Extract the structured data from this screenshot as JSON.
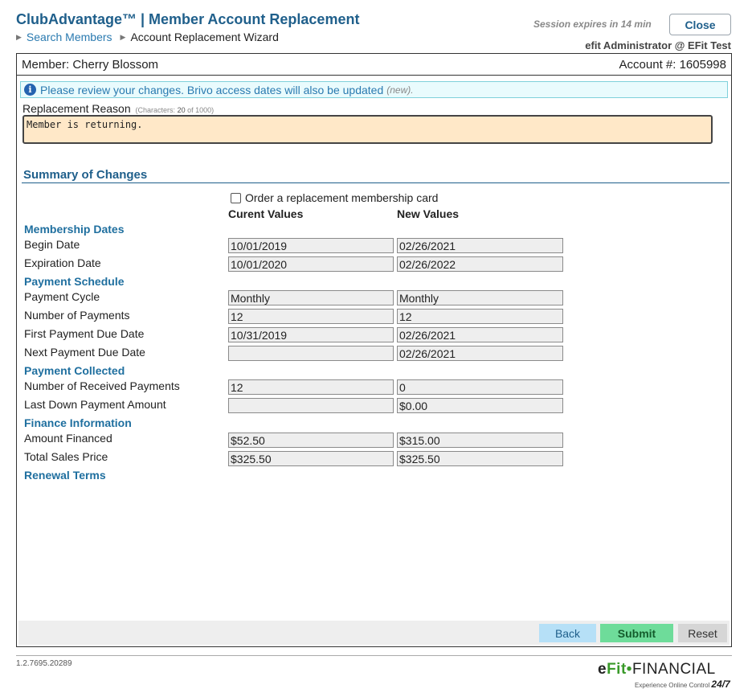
{
  "header": {
    "title": "ClubAdvantage™ | Member Account Replacement",
    "breadcrumb": [
      "Search Members",
      "Account Replacement Wizard"
    ],
    "session": "Session expires in 14 min",
    "close_label": "Close",
    "user": "efit Administrator @ EFit Test"
  },
  "member": {
    "name_label": "Member: Cherry Blossom",
    "account_label": "Account #: 1605998"
  },
  "info": {
    "message": "Please review your changes. Brivo access dates will also be updated",
    "note": "(new)."
  },
  "reason": {
    "label": "Replacement Reason",
    "chars_prefix": "(Characters:",
    "chars_count": "20",
    "chars_suffix": "of 1000)",
    "value": "Member is returning."
  },
  "summary": {
    "title": "Summary of Changes",
    "order_card_label": "Order a replacement membership card",
    "current_header": "Curent Values",
    "new_header": "New Values"
  },
  "groups": [
    {
      "title": "Membership Dates",
      "rows": [
        {
          "label": "Begin Date",
          "current": "10/01/2019",
          "new": "02/26/2021"
        },
        {
          "label": "Expiration Date",
          "current": "10/01/2020",
          "new": "02/26/2022"
        }
      ]
    },
    {
      "title": "Payment Schedule",
      "rows": [
        {
          "label": "Payment Cycle",
          "current": "Monthly",
          "new": "Monthly"
        },
        {
          "label": "Number of Payments",
          "current": "12",
          "new": "12"
        },
        {
          "label": "First Payment Due Date",
          "current": "10/31/2019",
          "new": "02/26/2021"
        },
        {
          "label": "Next Payment Due Date",
          "current": "",
          "new": "02/26/2021"
        }
      ]
    },
    {
      "title": "Payment Collected",
      "rows": [
        {
          "label": "Number of Received Payments",
          "current": "12",
          "new": "0"
        },
        {
          "label": "Last Down Payment Amount",
          "current": "",
          "new": "$0.00"
        }
      ]
    },
    {
      "title": "Finance Information",
      "rows": [
        {
          "label": "Amount Financed",
          "current": "$52.50",
          "new": "$315.00"
        },
        {
          "label": "Total Sales Price",
          "current": "$325.50",
          "new": "$325.50"
        }
      ]
    },
    {
      "title": "Renewal Terms",
      "rows": []
    }
  ],
  "buttons": {
    "back": "Back",
    "submit": "Submit",
    "reset": "Reset"
  },
  "footer": {
    "version": "1.2.7695.20289",
    "logo_e": "e",
    "logo_fit": "Fit",
    "logo_dot": "•",
    "logo_financial": "FINANCIAL",
    "logo_tagline": "Experience Online Control",
    "logo_247": "24/7"
  },
  "colors": {
    "brand": "#1f5f8b",
    "info_bg": "#e9fbfd",
    "reason_bg": "#ffe8c8",
    "submit_bg": "#6edc9a",
    "back_bg": "#b6e0f7"
  }
}
